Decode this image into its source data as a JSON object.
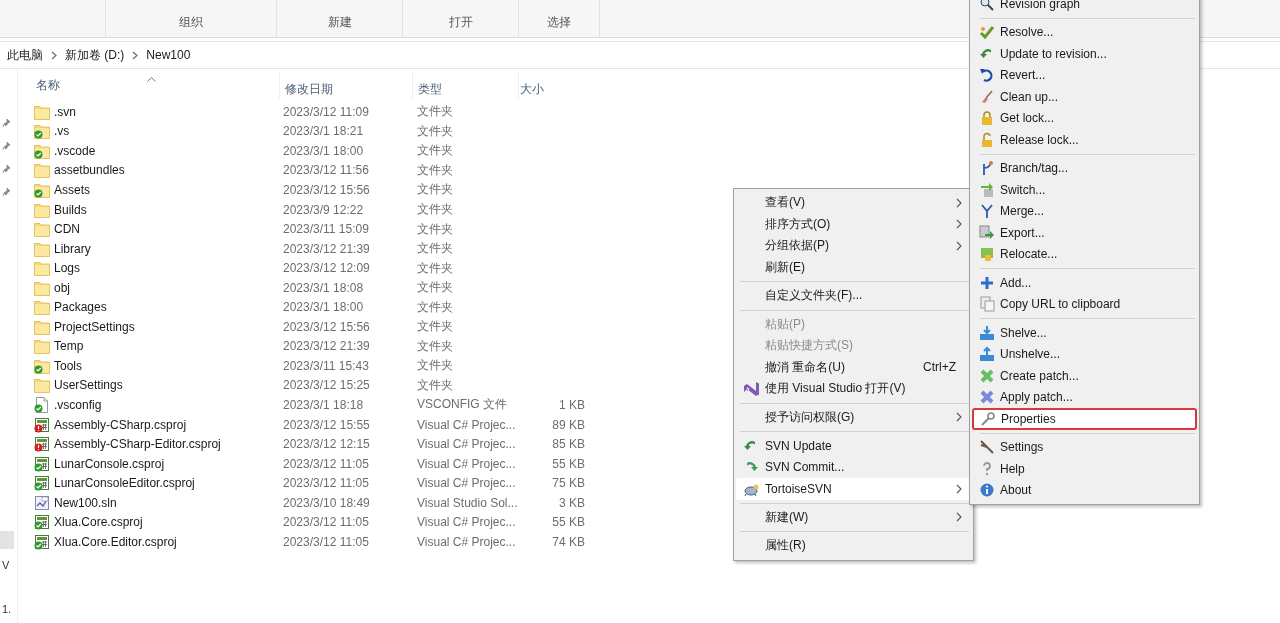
{
  "ribbon": {
    "groups": [
      {
        "label": "组织"
      },
      {
        "label": "新建"
      },
      {
        "label": "打开"
      },
      {
        "label": "选择"
      }
    ]
  },
  "address_bar": {
    "crumbs": [
      {
        "label": "此电脑"
      },
      {
        "label": "新加卷 (D:)"
      },
      {
        "label": "New100"
      }
    ]
  },
  "nav_pane": {
    "fragments": [
      "V",
      "1."
    ]
  },
  "file_list": {
    "columns": [
      {
        "label": "名称",
        "sorted": true
      },
      {
        "label": "修改日期",
        "sorted": false
      },
      {
        "label": "类型",
        "sorted": false
      },
      {
        "label": "大小",
        "sorted": false
      }
    ],
    "rows": [
      {
        "name": ".svn",
        "date": "2023/3/12 11:09",
        "type": "文件夹",
        "size": "",
        "kind": "folder",
        "versioned": false,
        "modified": false
      },
      {
        "name": ".vs",
        "date": "2023/3/1 18:21",
        "type": "文件夹",
        "size": "",
        "kind": "folder",
        "versioned": true,
        "modified": false
      },
      {
        "name": ".vscode",
        "date": "2023/3/1 18:00",
        "type": "文件夹",
        "size": "",
        "kind": "folder",
        "versioned": true,
        "modified": false
      },
      {
        "name": "assetbundles",
        "date": "2023/3/12 11:56",
        "type": "文件夹",
        "size": "",
        "kind": "folder",
        "versioned": false,
        "modified": false
      },
      {
        "name": "Assets",
        "date": "2023/3/12 15:56",
        "type": "文件夹",
        "size": "",
        "kind": "folder",
        "versioned": true,
        "modified": false
      },
      {
        "name": "Builds",
        "date": "2023/3/9 12:22",
        "type": "文件夹",
        "size": "",
        "kind": "folder",
        "versioned": false,
        "modified": false
      },
      {
        "name": "CDN",
        "date": "2023/3/11 15:09",
        "type": "文件夹",
        "size": "",
        "kind": "folder",
        "versioned": false,
        "modified": false
      },
      {
        "name": "Library",
        "date": "2023/3/12 21:39",
        "type": "文件夹",
        "size": "",
        "kind": "folder",
        "versioned": false,
        "modified": false
      },
      {
        "name": "Logs",
        "date": "2023/3/12 12:09",
        "type": "文件夹",
        "size": "",
        "kind": "folder",
        "versioned": false,
        "modified": false
      },
      {
        "name": "obj",
        "date": "2023/3/1 18:08",
        "type": "文件夹",
        "size": "",
        "kind": "folder",
        "versioned": false,
        "modified": false
      },
      {
        "name": "Packages",
        "date": "2023/3/1 18:00",
        "type": "文件夹",
        "size": "",
        "kind": "folder",
        "versioned": false,
        "modified": false
      },
      {
        "name": "ProjectSettings",
        "date": "2023/3/12 15:56",
        "type": "文件夹",
        "size": "",
        "kind": "folder",
        "versioned": false,
        "modified": false
      },
      {
        "name": "Temp",
        "date": "2023/3/12 21:39",
        "type": "文件夹",
        "size": "",
        "kind": "folder",
        "versioned": false,
        "modified": false
      },
      {
        "name": "Tools",
        "date": "2023/3/11 15:43",
        "type": "文件夹",
        "size": "",
        "kind": "folder",
        "versioned": true,
        "modified": false
      },
      {
        "name": "UserSettings",
        "date": "2023/3/12 15:25",
        "type": "文件夹",
        "size": "",
        "kind": "folder",
        "versioned": false,
        "modified": false
      },
      {
        "name": ".vsconfig",
        "date": "2023/3/1 18:18",
        "type": "VSCONFIG 文件",
        "size": "1 KB",
        "kind": "file",
        "versioned": true,
        "modified": false
      },
      {
        "name": "Assembly-CSharp.csproj",
        "date": "2023/3/12 15:55",
        "type": "Visual C# Projec...",
        "size": "89 KB",
        "kind": "csproj",
        "versioned": true,
        "modified": true
      },
      {
        "name": "Assembly-CSharp-Editor.csproj",
        "date": "2023/3/12 12:15",
        "type": "Visual C# Projec...",
        "size": "85 KB",
        "kind": "csproj",
        "versioned": true,
        "modified": true
      },
      {
        "name": "LunarConsole.csproj",
        "date": "2023/3/12 11:05",
        "type": "Visual C# Projec...",
        "size": "55 KB",
        "kind": "csproj",
        "versioned": true,
        "modified": false
      },
      {
        "name": "LunarConsoleEditor.csproj",
        "date": "2023/3/12 11:05",
        "type": "Visual C# Projec...",
        "size": "75 KB",
        "kind": "csproj",
        "versioned": true,
        "modified": false
      },
      {
        "name": "New100.sln",
        "date": "2023/3/10 18:49",
        "type": "Visual Studio Sol...",
        "size": "3 KB",
        "kind": "sln",
        "versioned": false,
        "modified": false
      },
      {
        "name": "Xlua.Core.csproj",
        "date": "2023/3/12 11:05",
        "type": "Visual C# Projec...",
        "size": "55 KB",
        "kind": "csproj",
        "versioned": true,
        "modified": false
      },
      {
        "name": "Xlua.Core.Editor.csproj",
        "date": "2023/3/12 11:05",
        "type": "Visual C# Projec...",
        "size": "74 KB",
        "kind": "csproj",
        "versioned": true,
        "modified": false
      }
    ]
  },
  "context_menu": {
    "items": [
      {
        "kind": "item",
        "label": "查看(V)",
        "submenu": true,
        "disabled": false,
        "selected": false
      },
      {
        "kind": "item",
        "label": "排序方式(O)",
        "submenu": true,
        "disabled": false,
        "selected": false
      },
      {
        "kind": "item",
        "label": "分组依据(P)",
        "submenu": true,
        "disabled": false,
        "selected": false
      },
      {
        "kind": "item",
        "label": "刷新(E)",
        "submenu": false,
        "disabled": false,
        "selected": false
      },
      {
        "kind": "separator"
      },
      {
        "kind": "item",
        "label": "自定义文件夹(F)...",
        "submenu": false,
        "disabled": false,
        "selected": false
      },
      {
        "kind": "separator"
      },
      {
        "kind": "item",
        "label": "粘贴(P)",
        "submenu": false,
        "disabled": true,
        "selected": false
      },
      {
        "kind": "item",
        "label": "粘贴快捷方式(S)",
        "submenu": false,
        "disabled": true,
        "selected": false
      },
      {
        "kind": "item",
        "label": "撤消 重命名(U)",
        "shortcut": "Ctrl+Z",
        "submenu": false,
        "disabled": false,
        "selected": false
      },
      {
        "kind": "item",
        "label": "使用 Visual Studio 打开(V)",
        "submenu": false,
        "disabled": false,
        "selected": false
      },
      {
        "kind": "separator"
      },
      {
        "kind": "item",
        "label": "授予访问权限(G)",
        "submenu": true,
        "disabled": false,
        "selected": false
      },
      {
        "kind": "separator"
      },
      {
        "kind": "item",
        "label": "SVN Update",
        "submenu": false,
        "disabled": false,
        "selected": false
      },
      {
        "kind": "item",
        "label": "SVN Commit...",
        "submenu": false,
        "disabled": false,
        "selected": false
      },
      {
        "kind": "item",
        "label": "TortoiseSVN",
        "submenu": true,
        "disabled": false,
        "selected": true
      },
      {
        "kind": "separator"
      },
      {
        "kind": "item",
        "label": "新建(W)",
        "submenu": true,
        "disabled": false,
        "selected": false
      },
      {
        "kind": "separator"
      },
      {
        "kind": "item",
        "label": "属性(R)",
        "submenu": false,
        "disabled": false,
        "selected": false
      }
    ]
  },
  "tortoise_submenu": {
    "items": [
      {
        "kind": "item",
        "label": "Revision graph",
        "selected": false
      },
      {
        "kind": "separator"
      },
      {
        "kind": "item",
        "label": "Resolve...",
        "selected": false
      },
      {
        "kind": "item",
        "label": "Update to revision...",
        "selected": false
      },
      {
        "kind": "item",
        "label": "Revert...",
        "selected": false
      },
      {
        "kind": "item",
        "label": "Clean up...",
        "selected": false
      },
      {
        "kind": "item",
        "label": "Get lock...",
        "selected": false
      },
      {
        "kind": "item",
        "label": "Release lock...",
        "selected": false
      },
      {
        "kind": "separator"
      },
      {
        "kind": "item",
        "label": "Branch/tag...",
        "selected": false
      },
      {
        "kind": "item",
        "label": "Switch...",
        "selected": false
      },
      {
        "kind": "item",
        "label": "Merge...",
        "selected": false
      },
      {
        "kind": "item",
        "label": "Export...",
        "selected": false
      },
      {
        "kind": "item",
        "label": "Relocate...",
        "selected": false
      },
      {
        "kind": "separator"
      },
      {
        "kind": "item",
        "label": "Add...",
        "selected": false
      },
      {
        "kind": "item",
        "label": "Copy URL to clipboard",
        "selected": false
      },
      {
        "kind": "separator"
      },
      {
        "kind": "item",
        "label": "Shelve...",
        "selected": false
      },
      {
        "kind": "item",
        "label": "Unshelve...",
        "selected": false
      },
      {
        "kind": "item",
        "label": "Create patch...",
        "selected": false
      },
      {
        "kind": "item",
        "label": "Apply patch...",
        "selected": false
      },
      {
        "kind": "item",
        "label": "Properties",
        "selected": true
      },
      {
        "kind": "separator"
      },
      {
        "kind": "item",
        "label": "Settings",
        "selected": false
      },
      {
        "kind": "item",
        "label": "Help",
        "selected": false
      },
      {
        "kind": "item",
        "label": "About",
        "selected": false
      }
    ]
  }
}
